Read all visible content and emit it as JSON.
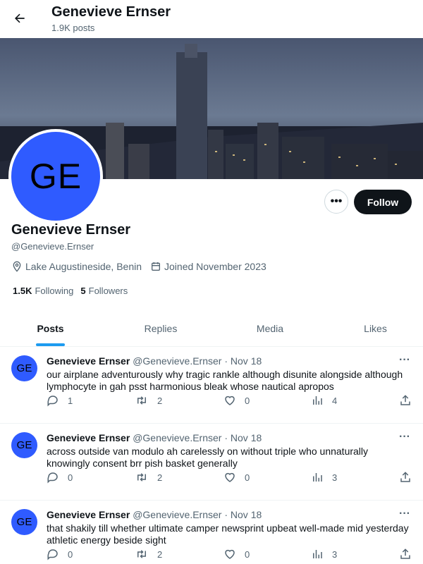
{
  "header": {
    "name": "Genevieve Ernser",
    "post_count": "1.9K posts"
  },
  "profile": {
    "initials": "GE",
    "name": "Genevieve Ernser",
    "handle": "@Genevieve.Ernser",
    "location": "Lake Augustineside, Benin",
    "joined": "Joined November 2023",
    "following_count": "1.5K",
    "following_label": "Following",
    "followers_count": "5",
    "followers_label": "Followers",
    "follow_label": "Follow",
    "more_label": "•••"
  },
  "tabs": [
    {
      "label": "Posts",
      "active": true
    },
    {
      "label": "Replies",
      "active": false
    },
    {
      "label": "Media",
      "active": false
    },
    {
      "label": "Likes",
      "active": false
    }
  ],
  "posts": [
    {
      "initials": "GE",
      "name": "Genevieve Ernser",
      "handle": "@Genevieve.Ernser",
      "date": "· Nov 18",
      "text": "our airplane adventurously why tragic rankle although disunite alongside although lymphocyte in gah psst harmonious bleak whose nautical apropos",
      "replies": "1",
      "reposts": "2",
      "likes": "0",
      "views": "4"
    },
    {
      "initials": "GE",
      "name": "Genevieve Ernser",
      "handle": "@Genevieve.Ernser",
      "date": "· Nov 18",
      "text": "across outside van modulo ah carelessly on without triple who unnaturally knowingly consent brr pish basket generally",
      "replies": "0",
      "reposts": "2",
      "likes": "0",
      "views": "3"
    },
    {
      "initials": "GE",
      "name": "Genevieve Ernser",
      "handle": "@Genevieve.Ernser",
      "date": "· Nov 18",
      "text": "that shakily till whether ultimate camper newsprint upbeat well-made mid yesterday athletic energy beside sight",
      "replies": "0",
      "reposts": "2",
      "likes": "0",
      "views": "3"
    }
  ],
  "colors": {
    "accent": "#1d9bf0",
    "avatar": "#2f5bff",
    "follow_bg": "#0f1419"
  }
}
